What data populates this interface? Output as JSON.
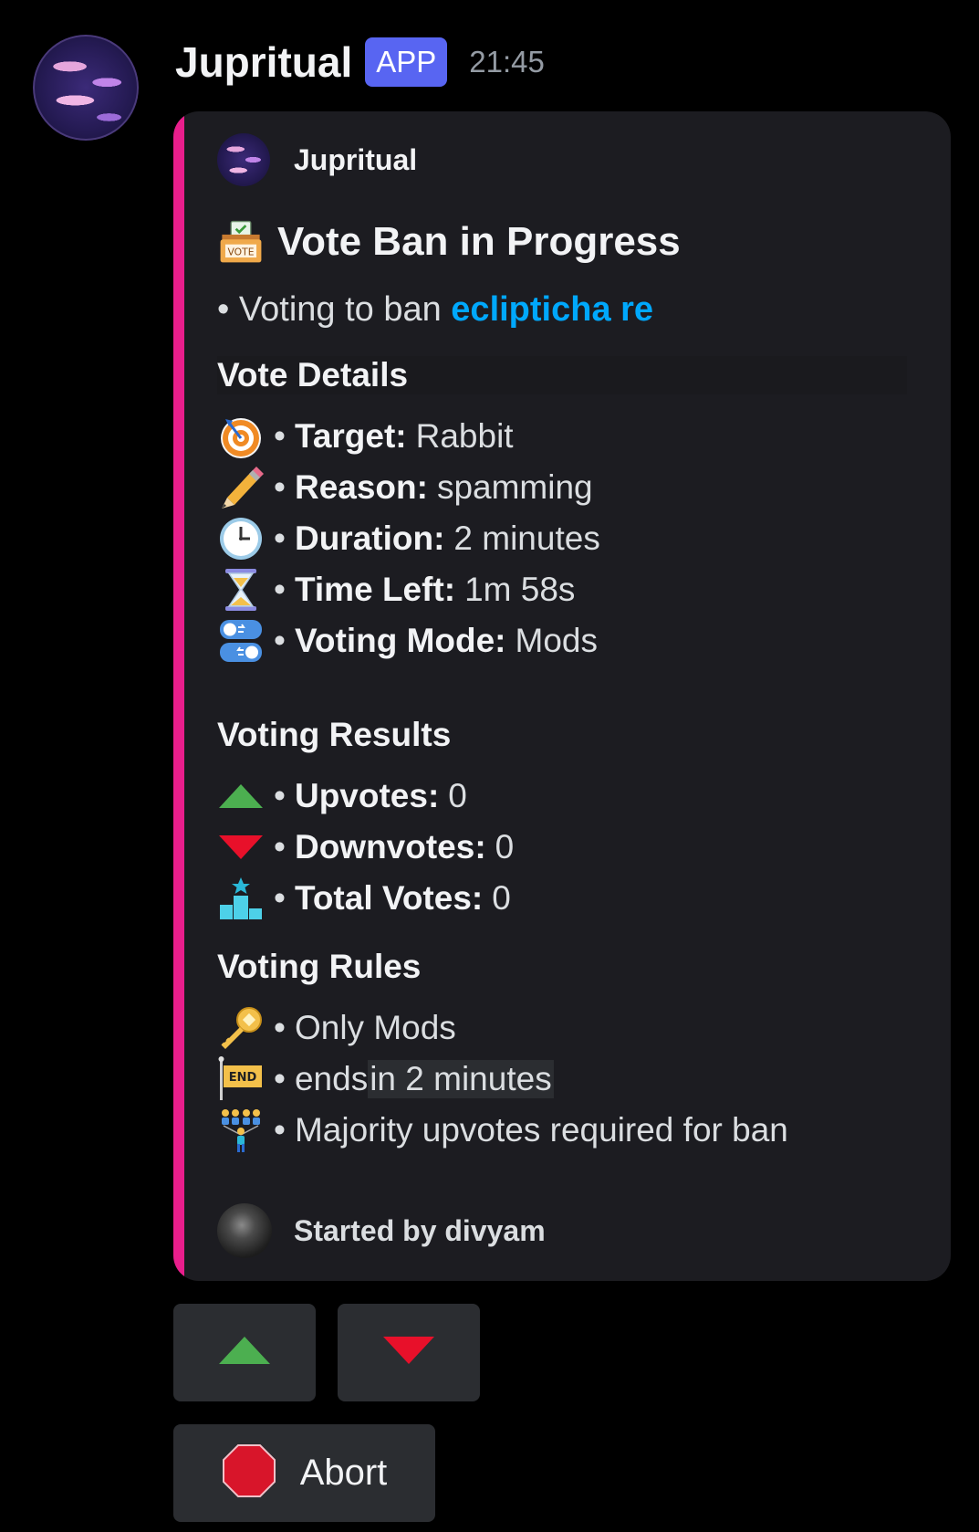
{
  "message": {
    "username": "Jupritual",
    "badge": "APP",
    "timestamp": "21:45"
  },
  "embed": {
    "author": "Jupritual",
    "title": "Vote Ban in Progress",
    "description_prefix": "Voting to ban ",
    "mention": "eclipticha re",
    "sections": {
      "details_title": "Vote Details",
      "results_title": "Voting Results",
      "rules_title": "Voting Rules"
    },
    "details": [
      {
        "icon": "target-icon",
        "label": "Target:",
        "value": "Rabbit"
      },
      {
        "icon": "pencil-icon",
        "label": "Reason:",
        "value": "spamming"
      },
      {
        "icon": "clock-icon",
        "label": "Duration:",
        "value": "2 minutes"
      },
      {
        "icon": "hourglass-icon",
        "label": "Time Left:",
        "value": "1m 58s"
      },
      {
        "icon": "toggle-icon",
        "label": "Voting Mode:",
        "value": "Mods"
      }
    ],
    "results": [
      {
        "icon": "upvote-icon",
        "label": "Upvotes:",
        "value": "0"
      },
      {
        "icon": "downvote-icon",
        "label": "Downvotes:",
        "value": "0"
      },
      {
        "icon": "podium-icon",
        "label": "Total Votes:",
        "value": "0"
      }
    ],
    "rules": [
      {
        "icon": "key-icon",
        "text": "Only Mods"
      },
      {
        "icon": "end-flag-icon",
        "text_prefix": "ends ",
        "text_code": "in 2 minutes"
      },
      {
        "icon": "people-icon",
        "text": "Majority upvotes required for ban"
      }
    ],
    "footer": "Started by divyam"
  },
  "buttons": {
    "upvote": "upvote-icon",
    "downvote": "downvote-icon",
    "abort_label": "Abort"
  },
  "colors": {
    "accent_bar": "#e91e8c",
    "mention": "#00a8fc",
    "badge": "#5865f2",
    "upvote": "#4caf50",
    "downvote": "#e8102a"
  }
}
